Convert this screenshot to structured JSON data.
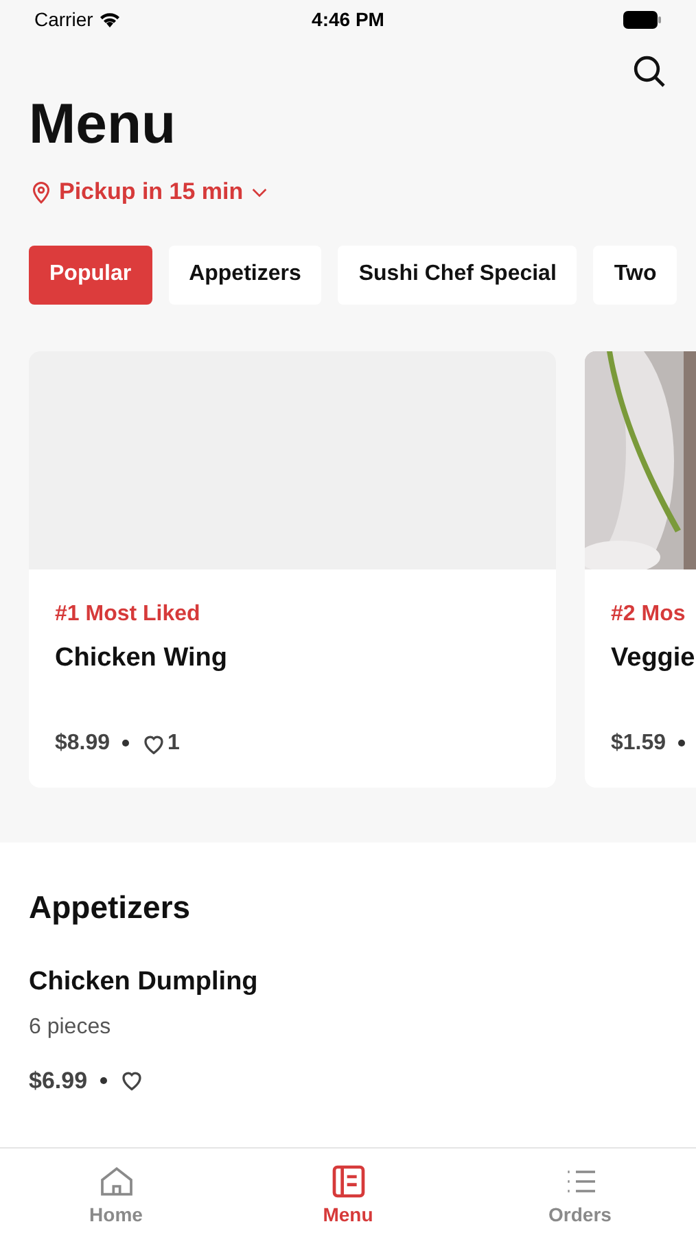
{
  "status_bar": {
    "carrier": "Carrier",
    "time": "4:46 PM"
  },
  "title": "Menu",
  "pickup": {
    "label": "Pickup in 15 min"
  },
  "categories": [
    {
      "label": "Popular",
      "selected": true
    },
    {
      "label": "Appetizers",
      "selected": false
    },
    {
      "label": "Sushi Chef Special",
      "selected": false
    },
    {
      "label": "Two",
      "selected": false
    }
  ],
  "featured": [
    {
      "rank": "#1 Most Liked",
      "name": "Chicken Wing",
      "price": "$8.99",
      "likes": "1",
      "kind": "placeholder"
    },
    {
      "rank": "#2 Mos",
      "name": "Veggie",
      "price": "$1.59",
      "kind": "picture"
    }
  ],
  "section": {
    "title": "Appetizers",
    "items": [
      {
        "name": "Chicken Dumpling",
        "description": "6 pieces",
        "price": "$6.99"
      }
    ]
  },
  "tab_bar": [
    {
      "label": "Home",
      "kind": "home",
      "selected": false
    },
    {
      "label": "Menu",
      "kind": "menu",
      "selected": true
    },
    {
      "label": "Orders",
      "kind": "list",
      "selected": false
    }
  ]
}
